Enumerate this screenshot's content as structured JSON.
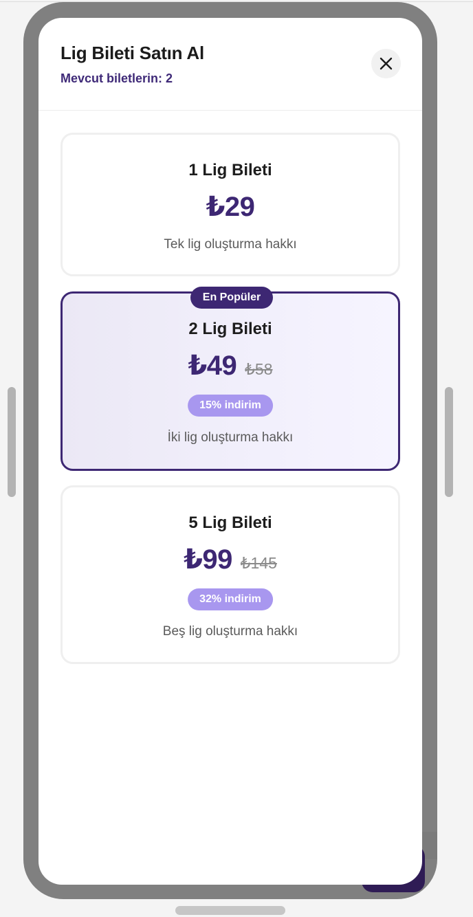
{
  "modal": {
    "title": "Lig Bileti Satın Al",
    "subtitle": "Mevcut biletlerin: 2",
    "close_icon": "close-icon"
  },
  "packages": [
    {
      "title": "1 Lig Bileti",
      "price": "₺29",
      "description": "Tek lig oluşturma hakkı"
    },
    {
      "badge": "En Popüler",
      "title": "2 Lig Bileti",
      "price": "₺49",
      "old_price": "₺58",
      "discount": "15% indirim",
      "description": "İki lig oluşturma hakkı"
    },
    {
      "title": "5 Lig Bileti",
      "price": "₺99",
      "old_price": "₺145",
      "discount": "32% indirim",
      "description": "Beş lig oluşturma hakkı"
    }
  ],
  "colors": {
    "accent": "#3d2773",
    "discount_bg": "#a897ef",
    "selected_bg": "#f2f0fc"
  }
}
